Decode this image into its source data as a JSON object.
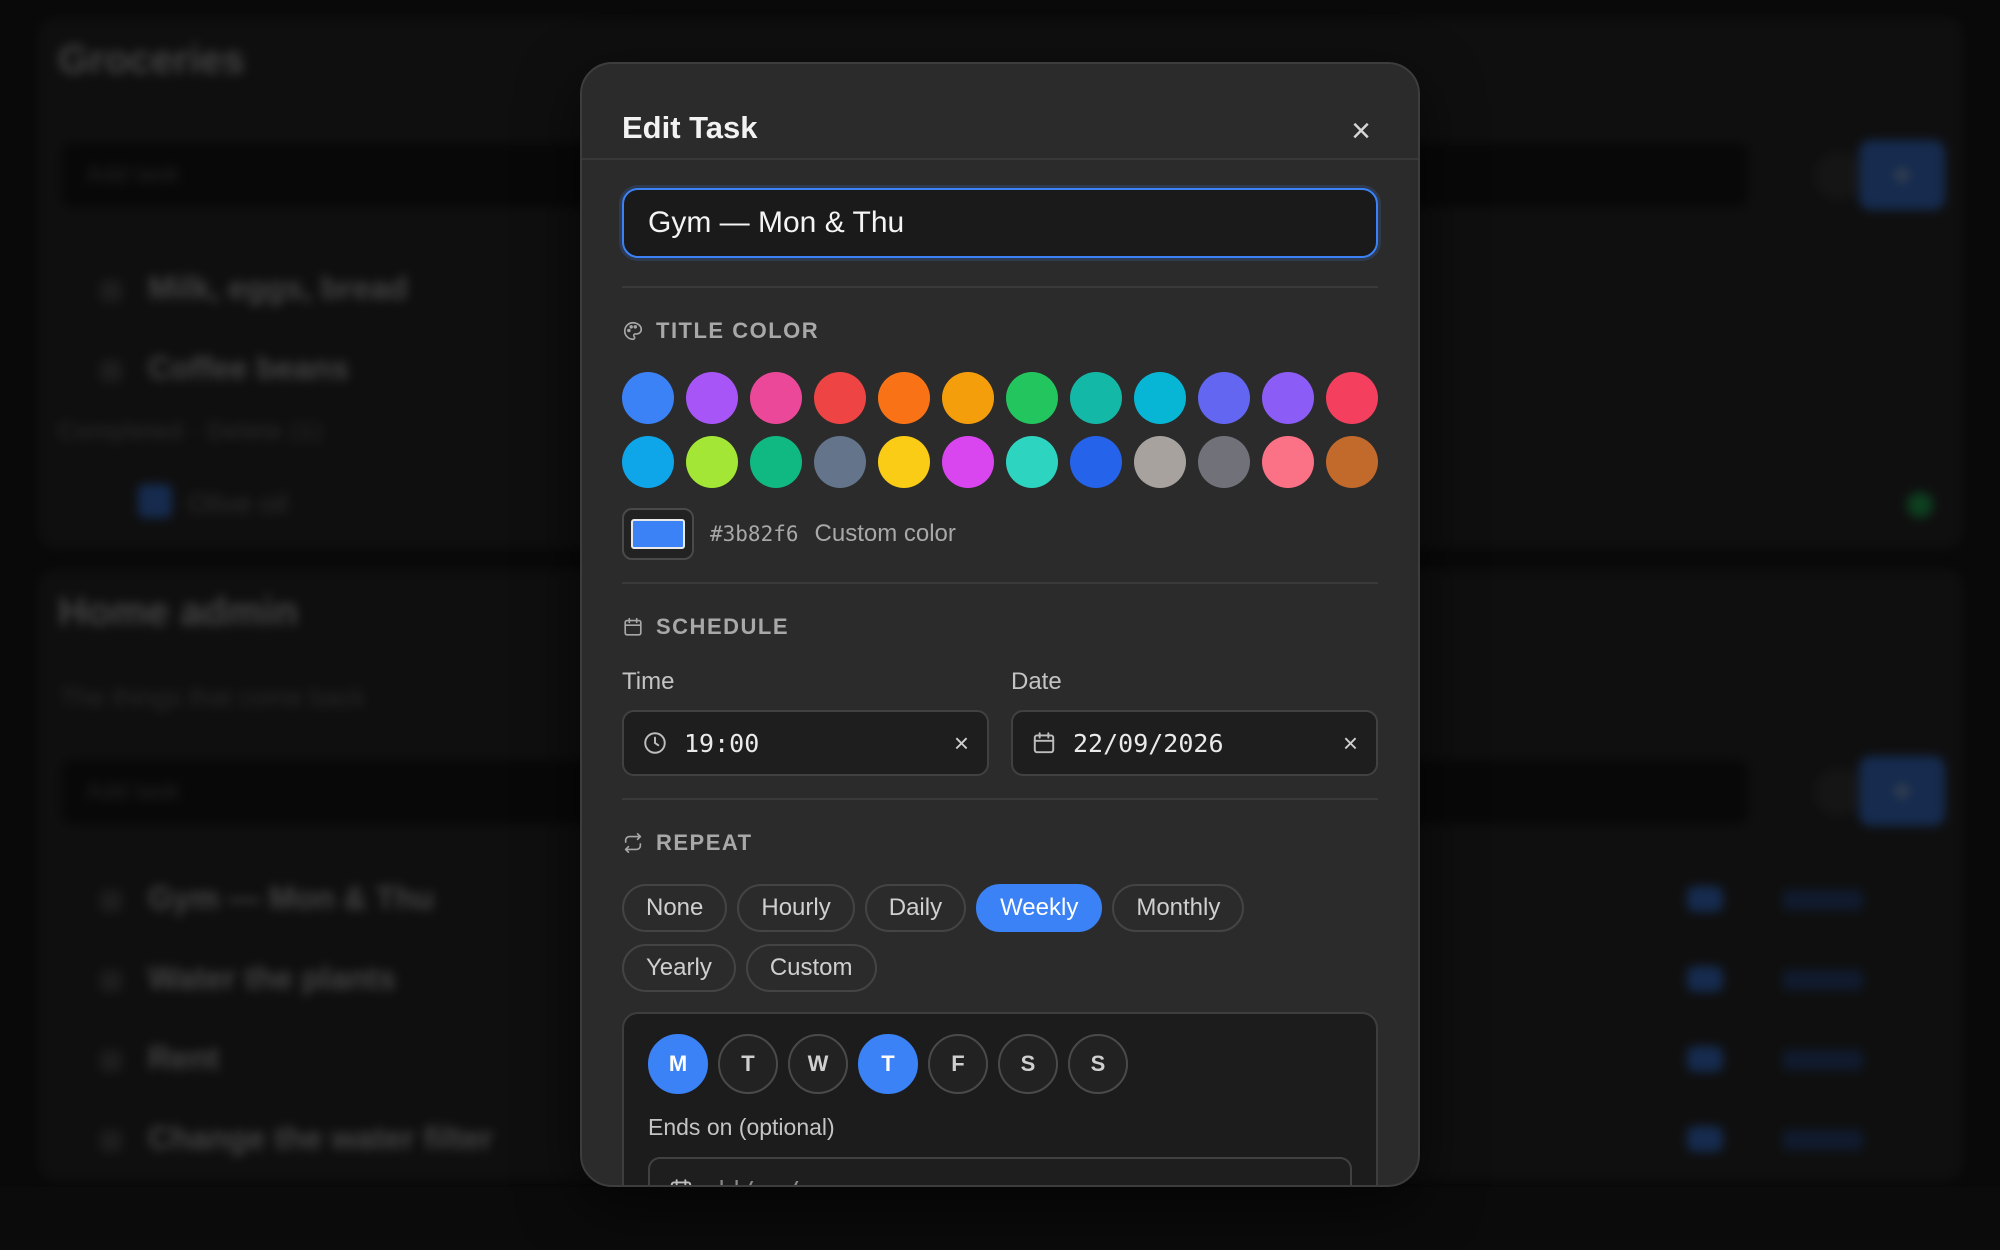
{
  "background": {
    "list1": {
      "title": "Groceries",
      "input_placeholder": "Add task",
      "items": [
        "Milk, eggs, bread",
        "Coffee beans"
      ],
      "completed_header": "Completed · Delete (1)",
      "completed_items": [
        "Olive oil"
      ]
    },
    "list2": {
      "title": "Home admin",
      "subtitle": "The things that come back",
      "input_placeholder": "Add task",
      "items": [
        "Gym — Mon & Thu",
        "Water the plants",
        "Rent",
        "Change the water filter"
      ]
    }
  },
  "modal": {
    "title": "Edit Task",
    "close_label": "×",
    "task_title_value": "Gym — Mon & Thu",
    "title_color": {
      "heading": "TITLE COLOR",
      "swatches": [
        "#3b82f6",
        "#a855f7",
        "#ec4899",
        "#ef4444",
        "#f97316",
        "#f59e0b",
        "#22c55e",
        "#14b8a6",
        "#06b6d4",
        "#6366f1",
        "#8b5cf6",
        "#f43f5e",
        "#0ea5e9",
        "#a3e635",
        "#10b981",
        "#64748b",
        "#facc15",
        "#d946ef",
        "#2dd4bf",
        "#2563eb",
        "#a8a29e",
        "#71717a",
        "#fb7185",
        "#c2692c"
      ],
      "custom_hex": "#3b82f6",
      "custom_label": "Custom color"
    },
    "schedule": {
      "heading": "SCHEDULE",
      "time_label": "Time",
      "time_value": "19:00",
      "date_label": "Date",
      "date_value": "22/09/2026",
      "clear_label": "×"
    },
    "repeat": {
      "heading": "REPEAT",
      "options": [
        "None",
        "Hourly",
        "Daily",
        "Weekly",
        "Monthly",
        "Yearly",
        "Custom"
      ],
      "selected": "Weekly",
      "days": [
        "M",
        "T",
        "W",
        "T",
        "F",
        "S",
        "S"
      ],
      "days_selected": [
        true,
        false,
        false,
        true,
        false,
        false,
        false
      ],
      "ends_label": "Ends on (optional)",
      "ends_placeholder": "dd/mm/yyyy"
    }
  },
  "colors": {
    "accent": "#3b82f6",
    "modal_bg": "#2b2b2b",
    "page_bg": "#111111"
  }
}
